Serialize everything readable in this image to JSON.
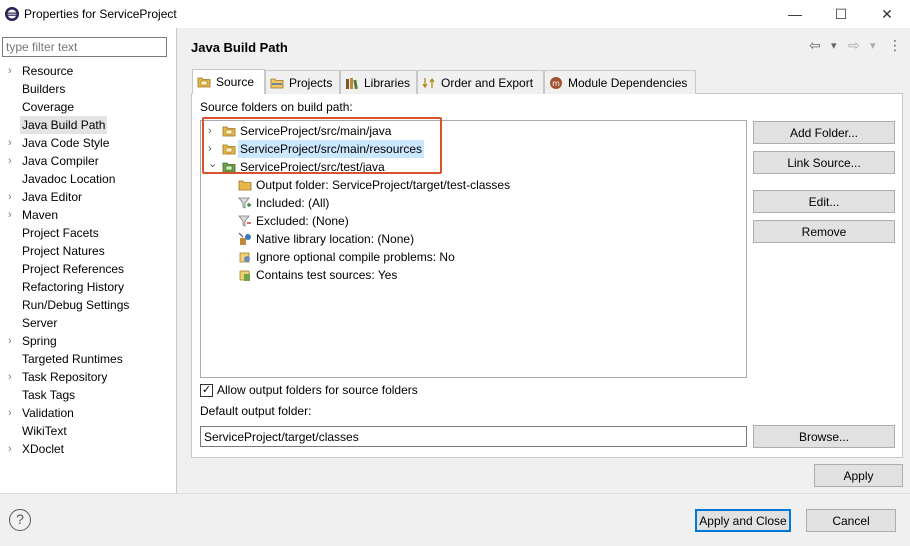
{
  "window": {
    "title": "Properties for ServiceProject",
    "minimize_glyph": "—",
    "maximize_glyph": "☐",
    "close_glyph": "✕"
  },
  "sidebar": {
    "filter_placeholder": "type filter text",
    "items": [
      {
        "label": "Resource",
        "expandable": true
      },
      {
        "label": "Builders",
        "expandable": false
      },
      {
        "label": "Coverage",
        "expandable": false
      },
      {
        "label": "Java Build Path",
        "expandable": false,
        "selected": true
      },
      {
        "label": "Java Code Style",
        "expandable": true
      },
      {
        "label": "Java Compiler",
        "expandable": true
      },
      {
        "label": "Javadoc Location",
        "expandable": false
      },
      {
        "label": "Java Editor",
        "expandable": true
      },
      {
        "label": "Maven",
        "expandable": true
      },
      {
        "label": "Project Facets",
        "expandable": false
      },
      {
        "label": "Project Natures",
        "expandable": false
      },
      {
        "label": "Project References",
        "expandable": false
      },
      {
        "label": "Refactoring History",
        "expandable": false
      },
      {
        "label": "Run/Debug Settings",
        "expandable": false
      },
      {
        "label": "Server",
        "expandable": false
      },
      {
        "label": "Spring",
        "expandable": true
      },
      {
        "label": "Targeted Runtimes",
        "expandable": false
      },
      {
        "label": "Task Repository",
        "expandable": true
      },
      {
        "label": "Task Tags",
        "expandable": false
      },
      {
        "label": "Validation",
        "expandable": true
      },
      {
        "label": "WikiText",
        "expandable": false
      },
      {
        "label": "XDoclet",
        "expandable": true
      }
    ]
  },
  "main": {
    "page_title": "Java Build Path",
    "nav": {
      "back": "⇦",
      "back_menu": "▾",
      "forward": "⇨",
      "forward_menu": "▾",
      "more": "⋮"
    },
    "tabs": [
      {
        "label": "Source",
        "icon": "source-folder-icon",
        "active": true
      },
      {
        "label": "Projects",
        "icon": "projects-icon",
        "active": false
      },
      {
        "label": "Libraries",
        "icon": "libraries-icon",
        "active": false
      },
      {
        "label": "Order and Export",
        "icon": "order-export-icon",
        "active": false
      },
      {
        "label": "Module Dependencies",
        "icon": "module-icon",
        "active": false
      }
    ],
    "source_label": "Source folders on build path:",
    "tree": [
      {
        "text": "ServiceProject/src/main/java",
        "level": 0,
        "chevron": "›",
        "icon": "package-folder-icon"
      },
      {
        "text": "ServiceProject/src/main/resources",
        "level": 0,
        "chevron": "›",
        "icon": "package-folder-icon",
        "selected": true
      },
      {
        "text": "ServiceProject/src/test/java",
        "level": 0,
        "chevron": "⌄",
        "icon": "test-package-folder-icon"
      },
      {
        "text": "Output folder: ServiceProject/target/test-classes",
        "level": 1,
        "icon": "output-folder-icon"
      },
      {
        "text": "Included: (All)",
        "level": 1,
        "icon": "included-filter-icon"
      },
      {
        "text": "Excluded: (None)",
        "level": 1,
        "icon": "excluded-filter-icon"
      },
      {
        "text": "Native library location: (None)",
        "level": 1,
        "icon": "native-library-icon"
      },
      {
        "text": "Ignore optional compile problems: No",
        "level": 1,
        "icon": "ignore-problems-icon"
      },
      {
        "text": "Contains test sources: Yes",
        "level": 1,
        "icon": "test-sources-icon"
      }
    ],
    "buttons": {
      "add_folder": "Add Folder...",
      "link_source": "Link Source...",
      "edit": "Edit...",
      "remove": "Remove",
      "browse": "Browse...",
      "apply": "Apply"
    },
    "allow_output_checkbox": {
      "label": "Allow output folders for source folders",
      "checked": true,
      "mark": "✓"
    },
    "default_output_label": "Default output folder:",
    "default_output_value": "ServiceProject/target/classes"
  },
  "footer": {
    "help_glyph": "?",
    "apply_close": "Apply and Close",
    "cancel": "Cancel"
  },
  "colors": {
    "highlight_box": "#d9522e",
    "selection": "#cce8ff",
    "primary_button_border": "#0078d7"
  }
}
